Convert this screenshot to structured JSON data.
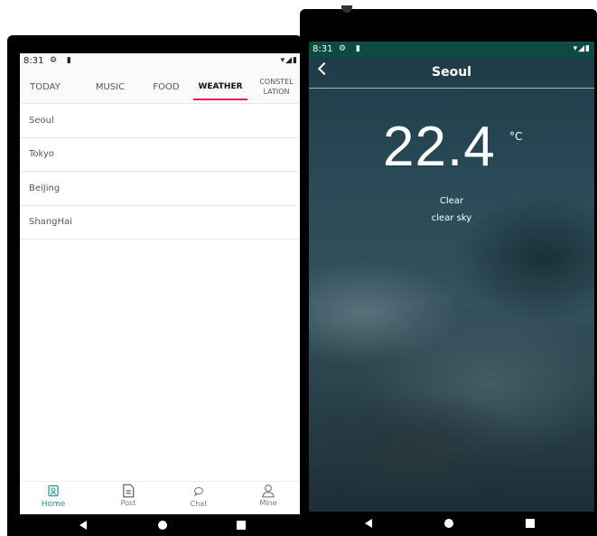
{
  "left_phone": {
    "status": {
      "time": "8:31",
      "left_icons": "⚙ ▮",
      "right_icons": "▾◢▮"
    },
    "tabs": [
      {
        "label": "TODAY",
        "active": false
      },
      {
        "label": "MUSIC",
        "active": false
      },
      {
        "label": "FOOD",
        "active": false
      },
      {
        "label": "WEATHER",
        "active": true
      },
      {
        "label": "CONSTEL LATION",
        "active": false
      }
    ],
    "cities": [
      "Seoul",
      "Tokyo",
      "BeiJing",
      "ShangHai"
    ],
    "bottom_nav": [
      {
        "label": "Home",
        "icon": "home-icon",
        "active": true
      },
      {
        "label": "Post",
        "icon": "post-icon",
        "active": false
      },
      {
        "label": "Chat",
        "icon": "chat-icon",
        "active": false
      },
      {
        "label": "Mine",
        "icon": "person-icon",
        "active": false
      }
    ],
    "colors": {
      "accent": "#e91e63",
      "nav_active": "#1a9a8a"
    }
  },
  "right_phone": {
    "status": {
      "time": "8:31",
      "left_icons": "⚙ ▮",
      "right_icons": "▾◢▮"
    },
    "title": "Seoul",
    "temperature": "22.4",
    "unit": "°C",
    "condition": "Clear",
    "description": "clear sky",
    "colors": {
      "status_bar": "#0d4a40"
    }
  }
}
